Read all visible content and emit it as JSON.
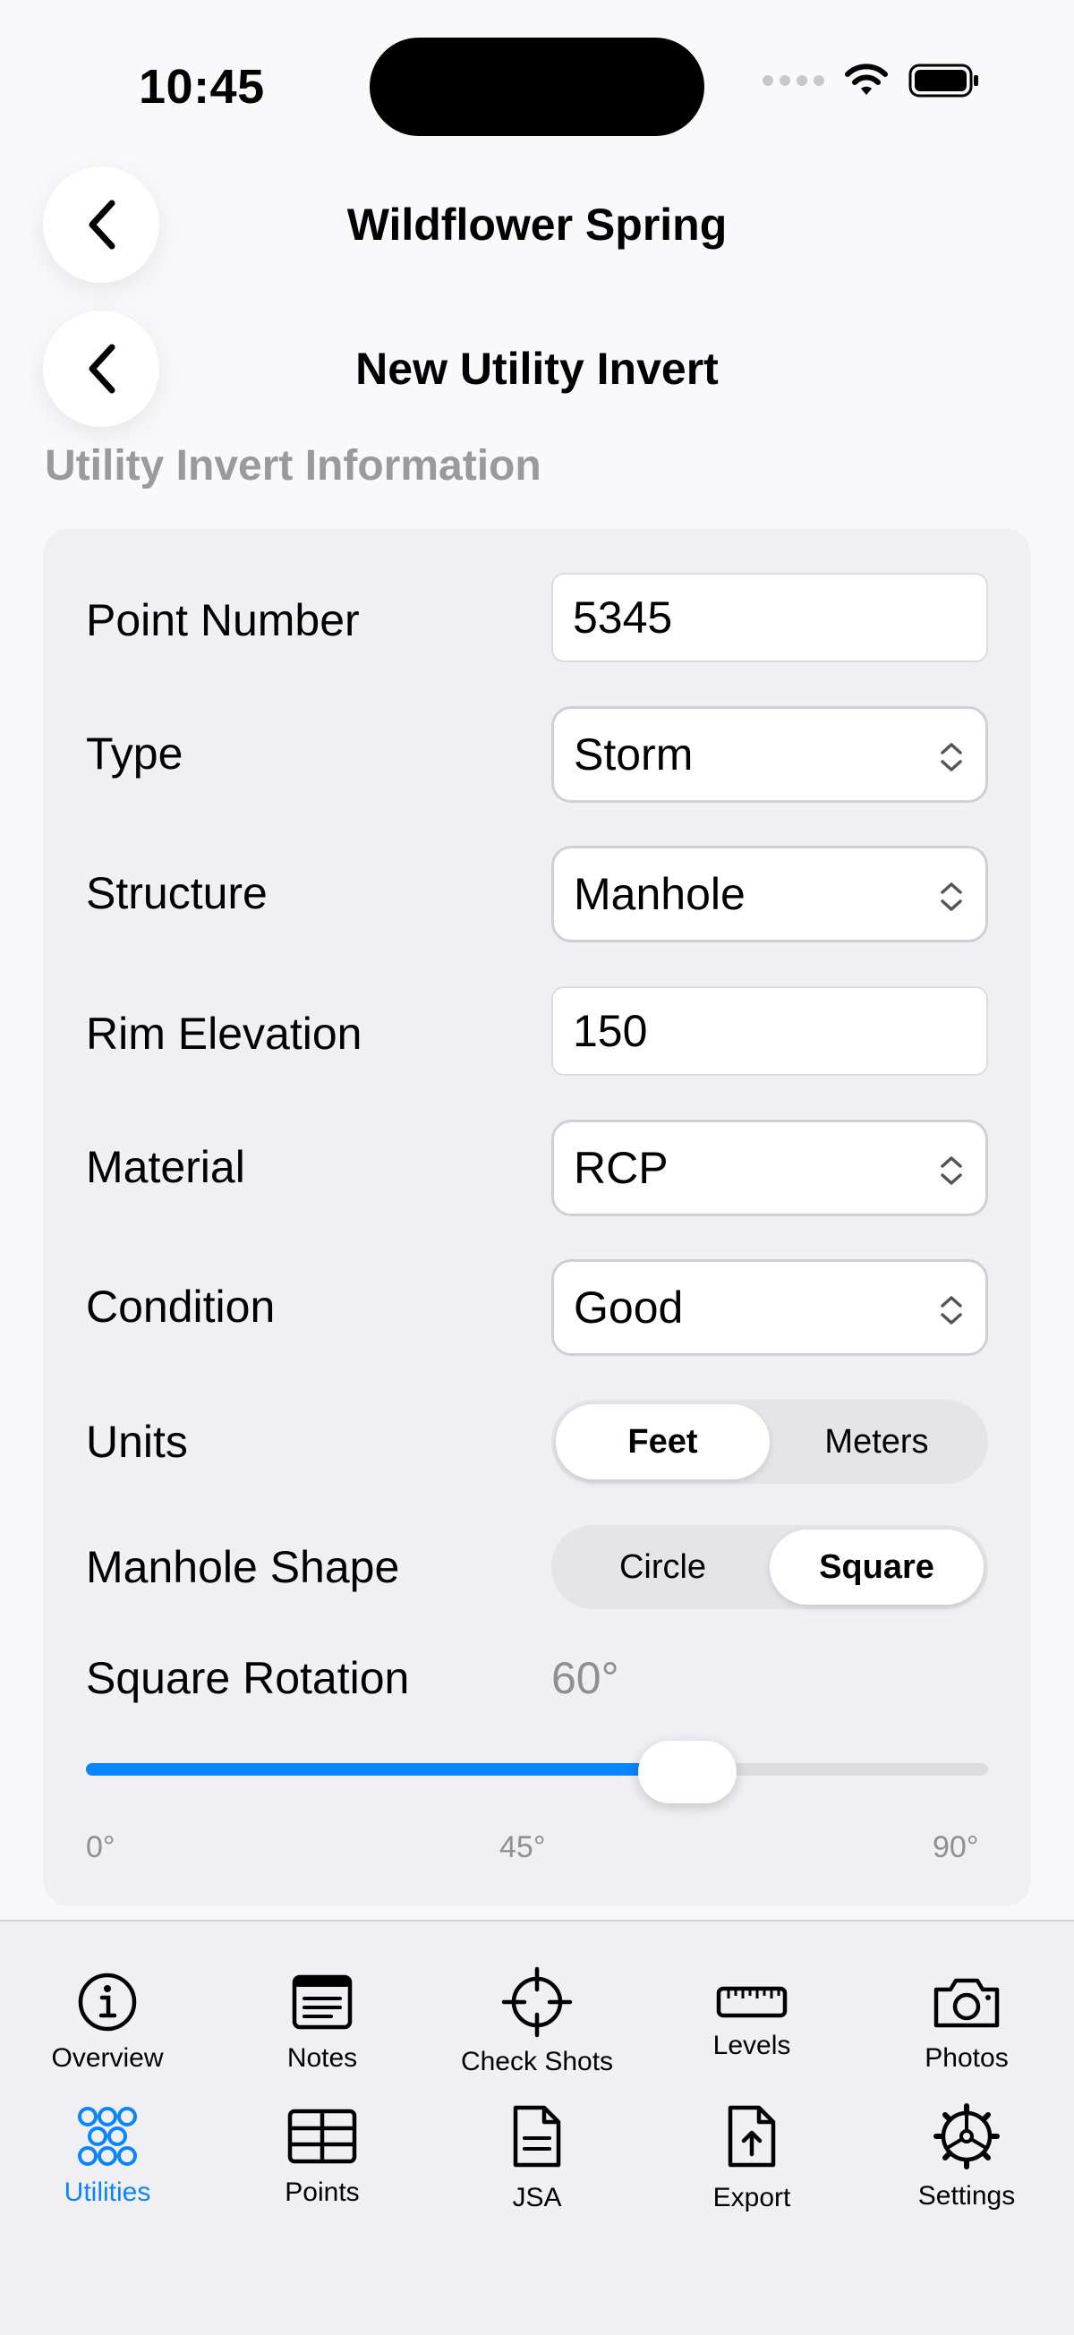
{
  "status_bar": {
    "time": "10:45"
  },
  "nav": {
    "parent_title": "Wildflower Spring",
    "title": "New Utility Invert"
  },
  "section_header": "Utility Invert Information",
  "form": {
    "point_number": {
      "label": "Point Number",
      "value": "5345"
    },
    "type": {
      "label": "Type",
      "value": "Storm"
    },
    "structure": {
      "label": "Structure",
      "value": "Manhole"
    },
    "rim_elevation": {
      "label": "Rim Elevation",
      "value": "150"
    },
    "material": {
      "label": "Material",
      "value": "RCP"
    },
    "condition": {
      "label": "Condition",
      "value": "Good"
    },
    "units": {
      "label": "Units",
      "options": [
        "Feet",
        "Meters"
      ],
      "selected": "Feet"
    },
    "manhole_shape": {
      "label": "Manhole Shape",
      "options": [
        "Circle",
        "Square"
      ],
      "selected": "Square"
    },
    "square_rotation": {
      "label": "Square Rotation",
      "value_text": "60°",
      "value": 60,
      "min": 0,
      "max": 90,
      "tick_labels": [
        "0°",
        "45°",
        "90°"
      ]
    }
  },
  "tabs": [
    {
      "label": "Overview",
      "icon": "info-circle-icon"
    },
    {
      "label": "Notes",
      "icon": "notes-icon"
    },
    {
      "label": "Check Shots",
      "icon": "crosshair-icon"
    },
    {
      "label": "Levels",
      "icon": "ruler-icon"
    },
    {
      "label": "Photos",
      "icon": "camera-icon"
    },
    {
      "label": "Utilities",
      "icon": "utilities-circles-icon",
      "active": true
    },
    {
      "label": "Points",
      "icon": "table-grid-icon"
    },
    {
      "label": "JSA",
      "icon": "document-icon"
    },
    {
      "label": "Export",
      "icon": "export-upload-icon"
    },
    {
      "label": "Settings",
      "icon": "gear-icon"
    }
  ],
  "colors": {
    "accent": "#0a84ff",
    "secondary_text": "#8e8e93",
    "card_bg": "#f0f0f4"
  }
}
